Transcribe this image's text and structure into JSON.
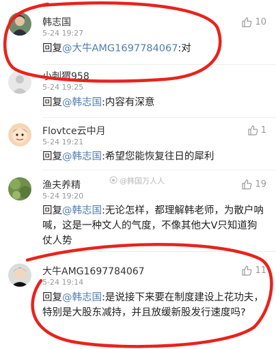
{
  "comments": [
    {
      "name": "韩志国",
      "time": "5-24 19:27",
      "reply_prefix": "回复",
      "mention": "@大牛AMG1697784067",
      "text": ":对",
      "likes": "10"
    },
    {
      "name": "小刺猬958",
      "time": "5-24 19:25",
      "reply_prefix": "回复",
      "mention": "@韩志国",
      "text": ":内容有深意",
      "likes": ""
    },
    {
      "name": "Flovtce云中月",
      "time": "5-24 19:21",
      "reply_prefix": "回复",
      "mention": "@韩志国",
      "text": ":希望您能恢复往日的犀利",
      "likes": "1"
    },
    {
      "name": "渔夫养精",
      "time": "5-24 19:20",
      "reply_prefix": "回复",
      "mention": "@韩志国",
      "text": ":无论怎样，都理解韩老师，为散户呐喊，这是一种文人的气度，不像其他大V只知道狗仗人势",
      "likes": "19"
    },
    {
      "name": "大牛AMG1697784067",
      "time": "5-24 19:14",
      "reply_prefix": "回复",
      "mention": "@韩志国",
      "text": ":是说接下来要在制度建设上花功夫，特别是大股东减持，并且放缓新股发行速度吗?",
      "likes": "11"
    }
  ],
  "watermark": "@韩国万人人",
  "colors": {
    "mention": "#507daf",
    "annotation": "#e8231c"
  },
  "icons": {
    "like": "thumbs-up-icon"
  }
}
